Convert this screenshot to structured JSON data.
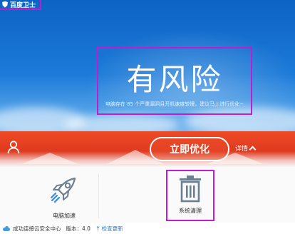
{
  "app": {
    "title": "百度卫士"
  },
  "hero": {
    "headline": "有风险",
    "description": "电脑存在 85 个严重漏洞且开机速度较慢，建议马上进行优化~"
  },
  "action_bar": {
    "optimize_label": "立即优化",
    "details_label": "详情"
  },
  "tools": [
    {
      "label": "电脑加速",
      "icon": "rocket-icon"
    },
    {
      "label": "系统清理",
      "icon": "trash-icon"
    }
  ],
  "status": {
    "connection": "成功连接云安全中心",
    "version": "版本：4.0",
    "update_label": "检查更新"
  },
  "colors": {
    "hero_blue": "#1c7ad8",
    "banner_red": "#e03a1f",
    "annotation": "#c21ccf",
    "link_blue": "#1a7ad9"
  }
}
